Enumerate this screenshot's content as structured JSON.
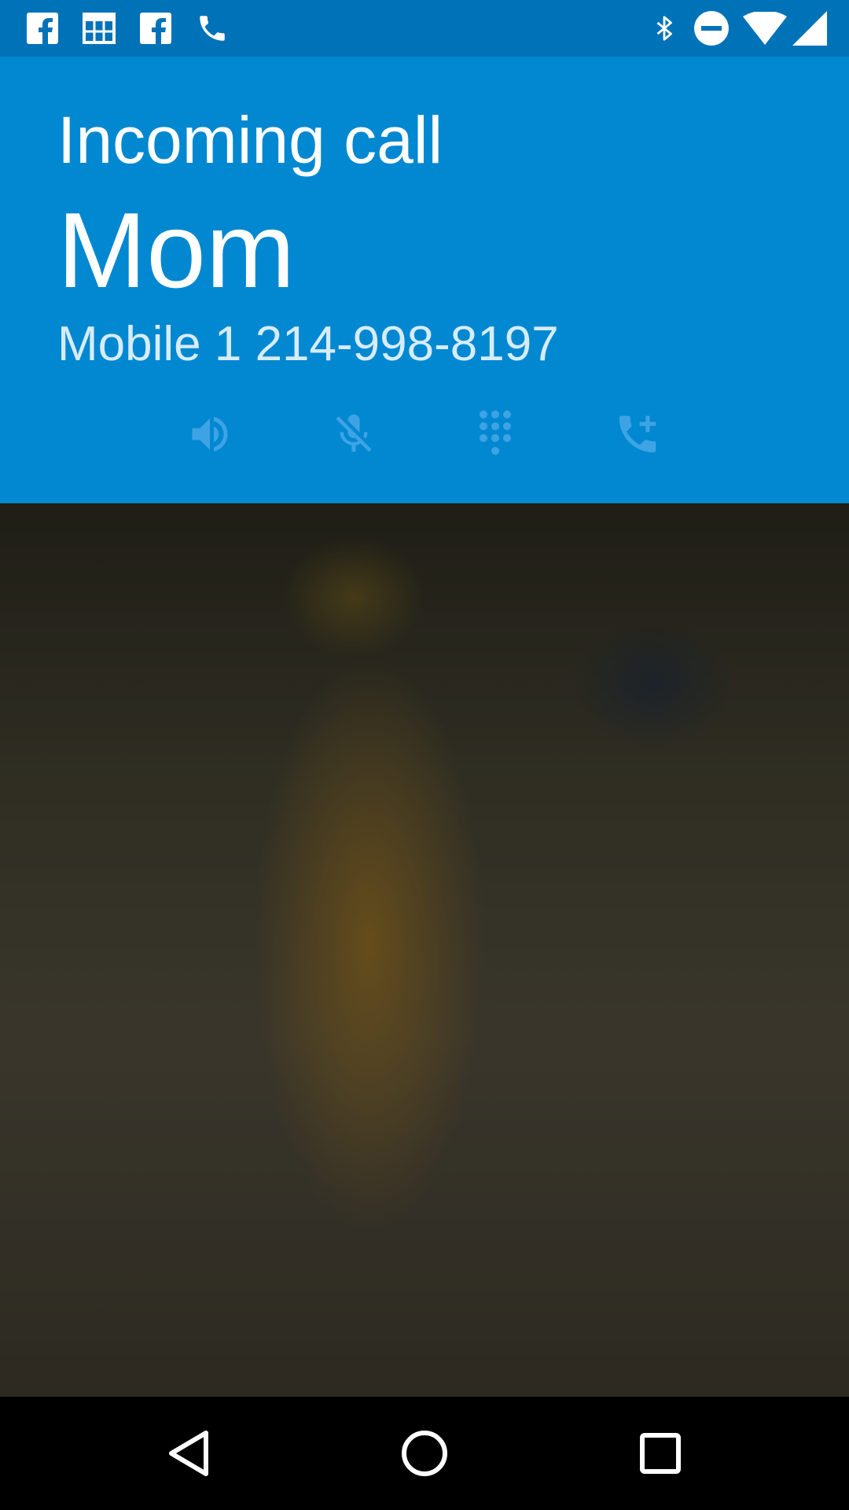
{
  "status_bar": {
    "left_icons": [
      "facebook-icon",
      "calendar-icon",
      "facebook-icon",
      "phone-icon"
    ],
    "right_icons": [
      "bluetooth-icon",
      "do-not-disturb-icon",
      "wifi-icon",
      "cell-signal-icon"
    ]
  },
  "call": {
    "state": "Incoming call",
    "caller_name": "Mom",
    "caller_number": "Mobile 1 214-998-8197"
  },
  "controls": [
    "speaker-icon",
    "mute-icon",
    "dialpad-icon",
    "add-call-icon"
  ],
  "answer_button": {
    "icon": "phone-icon"
  },
  "nav_bar": [
    "back-icon",
    "home-icon",
    "recents-icon"
  ],
  "colors": {
    "header_blue": "#0288d1",
    "status_bar_blue": "#0072b8",
    "answer_icon_gray": "#8a8a8a"
  }
}
